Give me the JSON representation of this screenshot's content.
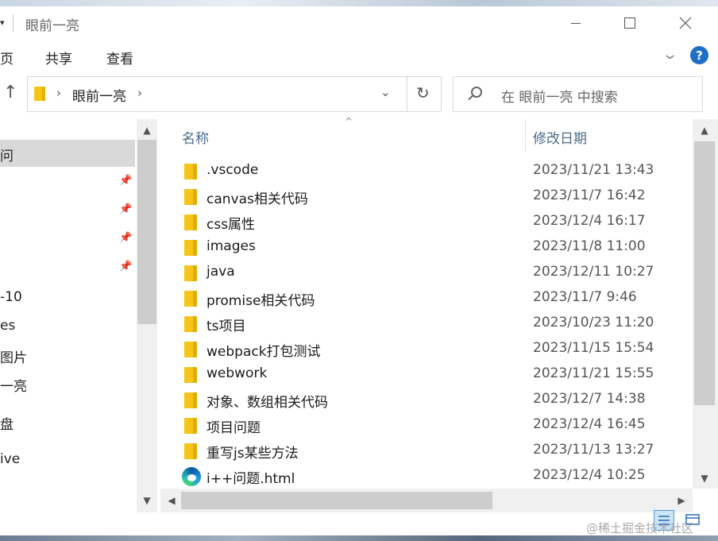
{
  "window": {
    "title": "眼前一亮"
  },
  "ribbon": {
    "tabs": [
      "页",
      "共享",
      "查看"
    ],
    "help_label": "?"
  },
  "address": {
    "path": "眼前一亮"
  },
  "search": {
    "placeholder": "在 眼前一亮 中搜索"
  },
  "sidebar": {
    "items": [
      {
        "label": "问",
        "pinned": false,
        "selected": true
      },
      {
        "label": "",
        "pinned": true
      },
      {
        "label": "",
        "pinned": true
      },
      {
        "label": "",
        "pinned": true
      },
      {
        "label": "",
        "pinned": true
      },
      {
        "label": "-10",
        "pinned": false
      },
      {
        "label": "es",
        "pinned": false
      },
      {
        "label": "图片",
        "pinned": false
      },
      {
        "label": "一亮",
        "pinned": false
      },
      {
        "label": "盘",
        "pinned": false
      },
      {
        "label": "ive",
        "pinned": false
      }
    ]
  },
  "columns": {
    "name": "名称",
    "modified": "修改日期"
  },
  "files": [
    {
      "name": ".vscode",
      "date": "2023/11/21 13:43",
      "type": "folder"
    },
    {
      "name": "canvas相关代码",
      "date": "2023/11/7 16:42",
      "type": "folder"
    },
    {
      "name": "css属性",
      "date": "2023/12/4 16:17",
      "type": "folder"
    },
    {
      "name": "images",
      "date": "2023/11/8 11:00",
      "type": "folder"
    },
    {
      "name": "java",
      "date": "2023/12/11 10:27",
      "type": "folder"
    },
    {
      "name": "promise相关代码",
      "date": "2023/11/7 9:46",
      "type": "folder"
    },
    {
      "name": "ts项目",
      "date": "2023/10/23 11:20",
      "type": "folder"
    },
    {
      "name": "webpack打包测试",
      "date": "2023/11/15 15:54",
      "type": "folder"
    },
    {
      "name": "webwork",
      "date": "2023/11/21 15:55",
      "type": "folder"
    },
    {
      "name": "对象、数组相关代码",
      "date": "2023/12/7 14:38",
      "type": "folder"
    },
    {
      "name": "项目问题",
      "date": "2023/12/4 16:45",
      "type": "folder"
    },
    {
      "name": "重写js某些方法",
      "date": "2023/11/13 13:27",
      "type": "folder"
    },
    {
      "name": "i++问题.html",
      "date": "2023/12/4 10:25",
      "type": "html"
    }
  ],
  "watermark": "@稀土掘金技术社区",
  "icons": {
    "folder": "folder-icon",
    "html": "edge-icon",
    "pin": "pin-icon"
  },
  "colors": {
    "accent": "#1e6fc9",
    "folder": "#f5c518",
    "selection": "#d9d9d9",
    "header_text": "#4a6a8a"
  }
}
